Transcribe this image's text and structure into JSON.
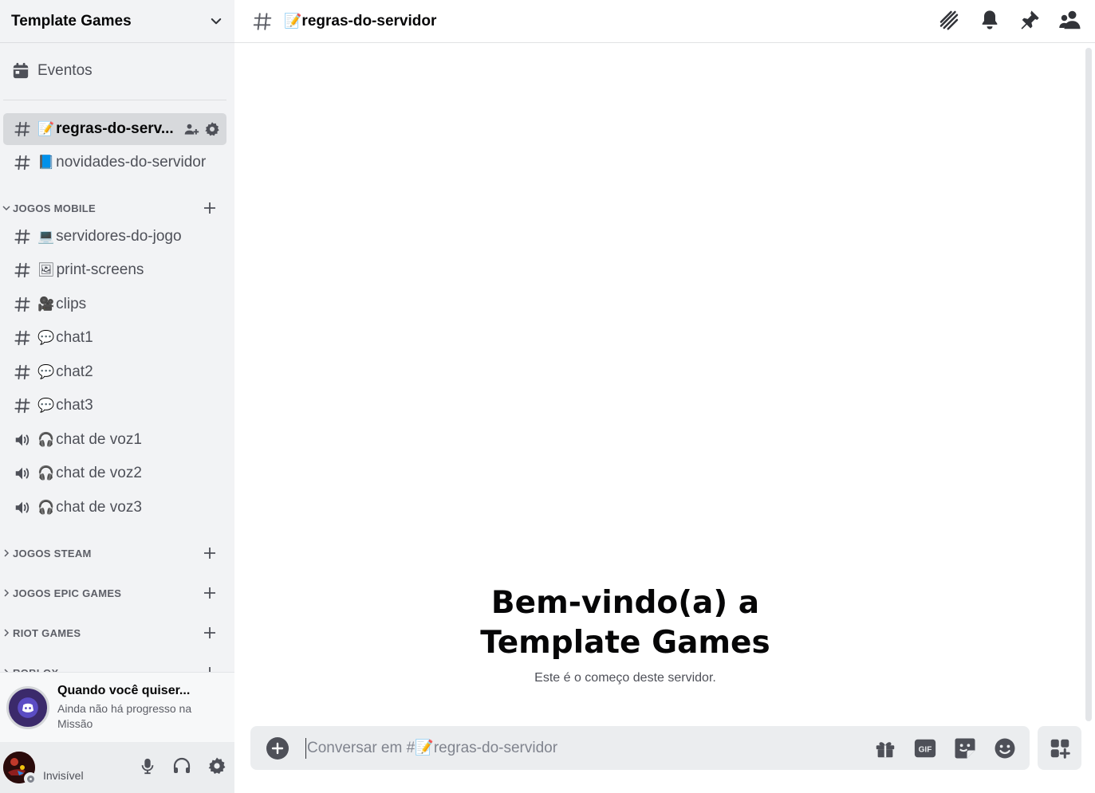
{
  "server": {
    "name": "Template Games"
  },
  "sidebar": {
    "events_label": "Eventos",
    "channels_top": [
      {
        "emoji": "📝",
        "name": "regras-do-servidor",
        "display": "regras-do-serv...",
        "type": "text",
        "active": true
      },
      {
        "emoji": "📘",
        "name": "novidades-do-servidor",
        "type": "text",
        "active": false
      }
    ],
    "categories": [
      {
        "name": "JOGOS MOBILE",
        "expanded": true
      },
      {
        "name": "JOGOS STEAM",
        "expanded": false
      },
      {
        "name": "JOGOS EPIC GAMES",
        "expanded": false
      },
      {
        "name": "RIOT GAMES",
        "expanded": false
      },
      {
        "name": "ROBLOX",
        "expanded": false
      }
    ],
    "mobile_channels": [
      {
        "emoji": "💻",
        "name": "servidores-do-jogo",
        "type": "text"
      },
      {
        "emoji": "🖼",
        "name": "print-screens",
        "type": "text"
      },
      {
        "emoji": "🎥",
        "name": "clips",
        "type": "text"
      },
      {
        "emoji": "💬",
        "name": "chat1",
        "type": "text"
      },
      {
        "emoji": "💬",
        "name": "chat2",
        "type": "text"
      },
      {
        "emoji": "💬",
        "name": "chat3",
        "type": "text"
      },
      {
        "emoji": "🎧",
        "name": "chat de voz1",
        "type": "voice"
      },
      {
        "emoji": "🎧",
        "name": "chat de voz2",
        "type": "voice"
      },
      {
        "emoji": "🎧",
        "name": "chat de voz3",
        "type": "voice"
      }
    ]
  },
  "quest": {
    "title": "Quando você quiser...",
    "subtitle": "Ainda não há progresso na Missão"
  },
  "user": {
    "status": "Invisível"
  },
  "topbar": {
    "channel_emoji": "📝",
    "channel_name": "regras-do-servidor"
  },
  "welcome": {
    "line1": "Bem-vindo(a) a",
    "line2": "Template Games",
    "subtitle": "Este é o começo deste servidor."
  },
  "composer": {
    "placeholder": "Conversar em #📝regras-do-servidor"
  },
  "colors": {
    "sidebar_bg": "#f2f3f5",
    "active_bg": "#d7d9dc",
    "text_muted": "#4e5058",
    "header_text": "#060607"
  }
}
